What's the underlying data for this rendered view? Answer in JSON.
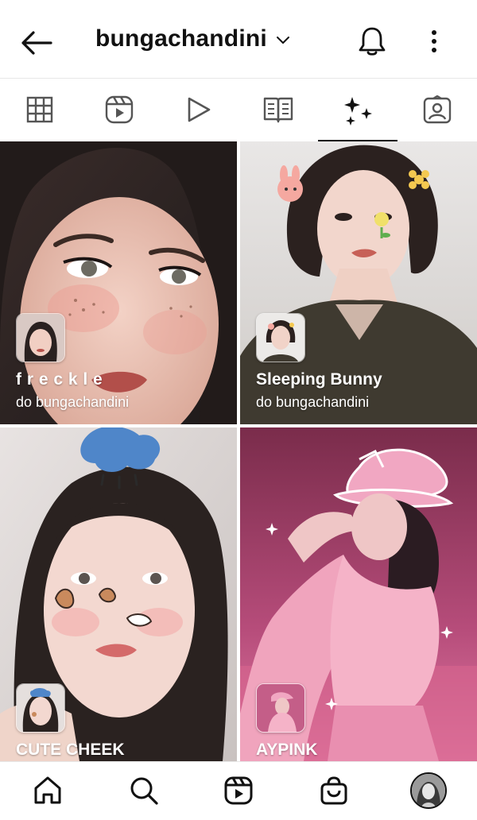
{
  "header": {
    "username": "bungachandini",
    "back_icon": "arrow-left-icon",
    "dropdown_icon": "chevron-down-icon",
    "notifications_icon": "bell-icon",
    "more_icon": "more-vertical-icon"
  },
  "tabs": [
    {
      "icon": "grid-icon",
      "active": false
    },
    {
      "icon": "reels-icon",
      "active": false
    },
    {
      "icon": "video-play-icon",
      "active": false
    },
    {
      "icon": "guides-icon",
      "active": false
    },
    {
      "icon": "effects-sparkles-icon",
      "active": true
    },
    {
      "icon": "tagged-icon",
      "active": false
    }
  ],
  "effects": [
    {
      "title": "f r e c k l e",
      "creator": "do bungachandini"
    },
    {
      "title": "Sleeping Bunny",
      "creator": "do bungachandini"
    },
    {
      "title": "CUTE CHEEK",
      "creator": ""
    },
    {
      "title": "AYPINK",
      "creator": ""
    }
  ],
  "bottom_nav": [
    {
      "icon": "home-icon"
    },
    {
      "icon": "search-icon"
    },
    {
      "icon": "reels-icon"
    },
    {
      "icon": "shop-bag-icon"
    },
    {
      "icon": "profile-avatar"
    }
  ],
  "colors": {
    "text": "#111111",
    "divider": "#e7e7e7",
    "background": "#ffffff"
  }
}
